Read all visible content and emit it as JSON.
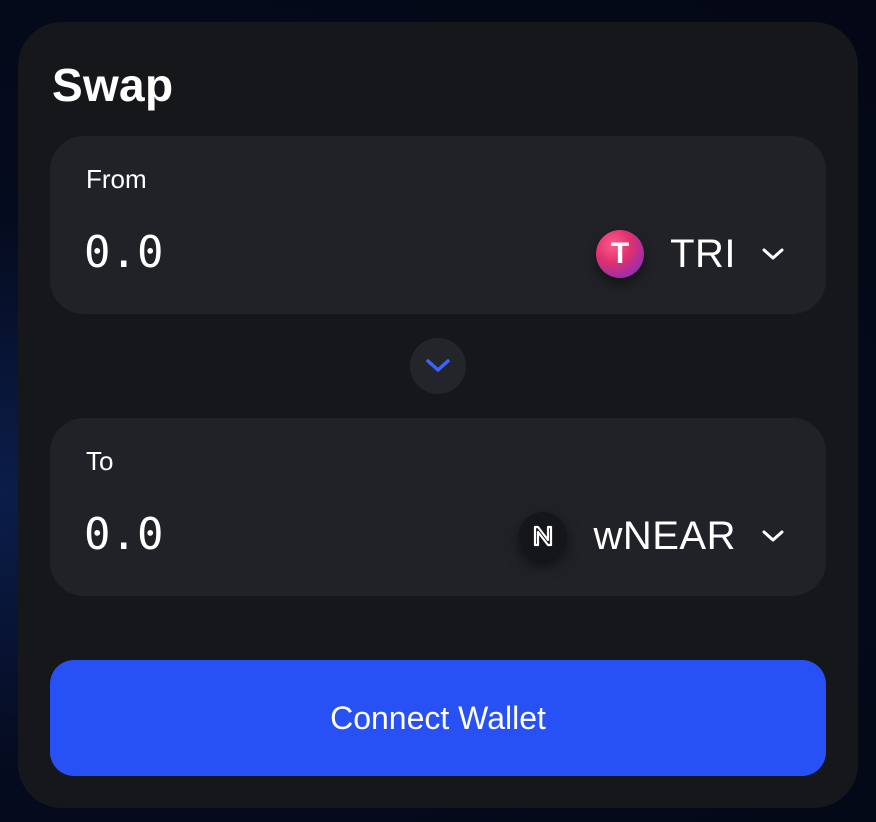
{
  "swap": {
    "title": "Swap",
    "from": {
      "label": "From",
      "amount_placeholder": "0.0",
      "token": {
        "symbol": "TRI",
        "logo_letter": "T",
        "icon": "tri-token-icon"
      }
    },
    "to": {
      "label": "To",
      "amount_placeholder": "0.0",
      "token": {
        "symbol": "wNEAR",
        "icon": "near-token-icon"
      }
    },
    "switch_icon": "chevron-down-icon",
    "connect_label": "Connect Wallet"
  },
  "colors": {
    "accent": "#2751f5",
    "card_bg": "#16171b",
    "panel_bg": "#212227",
    "switch_chevron": "#3b63ff"
  }
}
